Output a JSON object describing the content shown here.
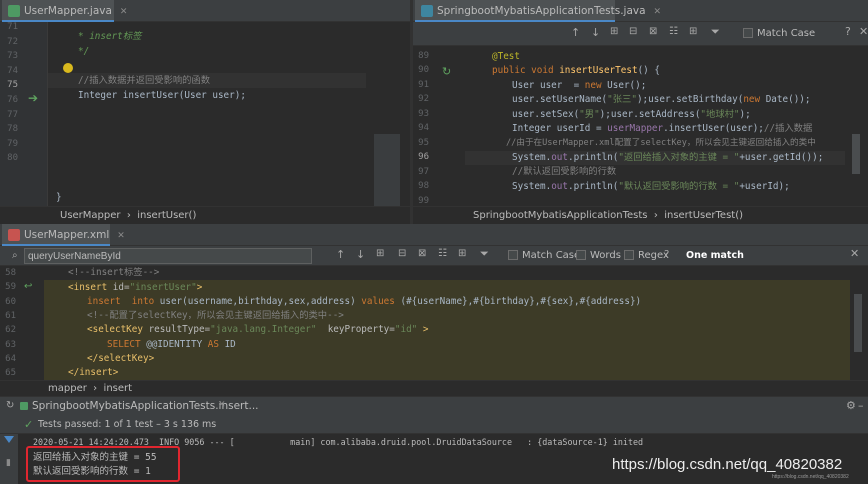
{
  "left_editor": {
    "tab_title": "UserMapper.java",
    "lines": [
      "71",
      "72",
      "73",
      "74",
      "75",
      "76",
      "77",
      "78",
      "79",
      "80"
    ],
    "doc_comment_text": "* insert标签",
    "doc_comment_end": "*/",
    "comment_line": "//插入数据并返回受影响的函数",
    "method_type": "Integer",
    "method_name": "insertUser",
    "method_params": "(User user);",
    "closing_brace": "}",
    "breadcrumb": [
      "UserMapper",
      "insertUser()"
    ]
  },
  "right_editor": {
    "tab_title": "SpringbootMybatisApplicationTests.java",
    "match_case_label": "Match Case",
    "lines": [
      "89",
      "90",
      "91",
      "92",
      "93",
      "94",
      "95",
      "96",
      "97",
      "98",
      "99"
    ],
    "annotation": "@Test",
    "l90_kw": "public void",
    "l90_name": "insertUserTest",
    "l90_rest": "() {",
    "l91_a": "User user  = ",
    "l91_kw": "new",
    "l91_b": " User();",
    "l92_a": "user.setUserName(",
    "l92_str": "\"张三\"",
    "l92_b": ");user.setBirthday(",
    "l92_kw": "new",
    "l92_c": " Date());",
    "l93_a": "user.setSex(",
    "l93_str1": "\"男\"",
    "l93_b": ");user.setAddress(",
    "l93_str2": "\"地球村\"",
    "l93_c": ");",
    "l94_a": "Integer userId = ",
    "l94_fld": "userMapper",
    "l94_b": ".insertUser(user);",
    "l94_cm": "//插入数据",
    "l95_cm": "//由于在UserMapper.xml配置了selectKey，所以会见主键返回给插入的类中",
    "l96_a": "System.",
    "l96_fld": "out",
    "l96_b": ".println(",
    "l96_str": "\"返回给插入对象的主键 = \"",
    "l96_c": "+user.getId());",
    "l97_cm": "//默认返回受影响的行数",
    "l98_a": "System.",
    "l98_fld": "out",
    "l98_b": ".println(",
    "l98_str": "\"默认返回受影响的行数 = \"",
    "l98_c": "+userId);",
    "breadcrumb": [
      "SpringbootMybatisApplicationTests",
      "insertUserTest()"
    ]
  },
  "xml_editor": {
    "tab_title": "UserMapper.xml",
    "search_value": "queryUserNameById",
    "match_case_label": "Match Case",
    "words_label": "Words",
    "regex_label": "Regex",
    "match_count": "One match",
    "lines": [
      "58",
      "59",
      "60",
      "61",
      "62",
      "63",
      "64",
      "65"
    ],
    "l58": "<!--insert标签-->",
    "l59_open": "<insert",
    "l59_attr": " id=",
    "l59_val": "\"insertUser\"",
    "l59_close": ">",
    "l60_kw1": "insert  into",
    "l60_a": " user(username,birthday,sex,address) ",
    "l60_kw2": "values",
    "l60_b": " (#{userName},#{birthday},#{sex},#{address})",
    "l61": "<!--配置了selectKey，所以会见主键返回给插入的类中-->",
    "l62_open": "<selectKey",
    "l62_attr1": " resultType=",
    "l62_val1": "\"java.lang.Integer\"",
    "l62_attr2": "  keyProperty=",
    "l62_val2": "\"id\"",
    "l62_close": " >",
    "l63_kw": "SELECT",
    "l63_a": " @@IDENTITY ",
    "l63_kw2": "AS",
    "l63_b": " ID",
    "l64": "</selectKey>",
    "l65": "</insert>",
    "breadcrumb": [
      "mapper",
      "insert"
    ]
  },
  "run_panel": {
    "tab_title": "SpringbootMybatisApplicationTests.insert...",
    "status": "Tests passed: 1 of 1 test – 3 s 136 ms",
    "log_line": "2020-05-21 14:24:20.473  INFO 9056 --- [           main] com.alibaba.druid.pool.DruidDataSource   : {dataSource-1} inited",
    "output1": "返回给插入对象的主键 = 55",
    "output2": "默认返回受影响的行数 = 1"
  },
  "watermark": "https://blog.csdn.net/qq_40820382",
  "watermark_small": "https://blog.csdn.net/qq_40820382",
  "colors": {
    "background": "#2b2b2b",
    "highlight_box": "#e0262f",
    "xml_selection": "#3d3b27"
  }
}
